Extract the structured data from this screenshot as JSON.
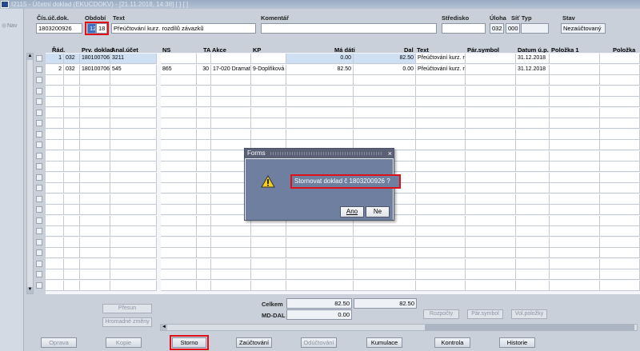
{
  "window": {
    "title": "I2115 - Účetní doklad (EKUCDOKV) - [21.11.2018, 14:38] [ ] [ ]"
  },
  "nav": {
    "label": "Nav"
  },
  "header": {
    "labels": {
      "cis_uc_dok": "Čís.úč.dok.",
      "obdobi": "Období",
      "text": "Text",
      "komentar": "Komentář",
      "stredisko": "Středisko",
      "uloha": "Úloha",
      "sit_typ": "Síť Typ",
      "stav": "Stav"
    },
    "values": {
      "cis_uc_dok": "1803200926",
      "obdobi_mesic": "12",
      "obdobi_rok": "18",
      "text": "Přeúčtování kurz. rozdílů závazků",
      "komentar": "",
      "stredisko": "",
      "uloha": "032",
      "sit": "000",
      "typ": "",
      "stav": "Nezaúčtovaný"
    }
  },
  "grid": {
    "columns": [
      "Řád.",
      "Prv. doklad",
      "Anal.účet",
      "NS",
      "TA Akce",
      "KP",
      "Má dáti",
      "Dal",
      "Text",
      "Pár.symbol",
      "Datum ú.p.",
      "Položka 1",
      "Položka"
    ],
    "rows": [
      {
        "rad": "1",
        "uloha": "032",
        "prv": "1801007067",
        "anal": "3211",
        "ns": "",
        "ta": "",
        "akce": "",
        "kp": "",
        "md": "0.00",
        "dal": "82.50",
        "text": "Přeúčtování kurz. r",
        "par": "",
        "datum": "31.12.2018"
      },
      {
        "rad": "2",
        "uloha": "032",
        "prv": "1801007067",
        "anal": "545",
        "ns": "865",
        "ta": "30",
        "akce": "17-020 Dramat",
        "kp": "9-Doplňková",
        "md": "82.50",
        "dal": "0.00",
        "text": "Přeúčtování kurz. r",
        "par": "",
        "datum": "31.12.2018"
      }
    ]
  },
  "totals": {
    "celkem_label": "Celkem",
    "celkem_md": "82.50",
    "celkem_dal": "82.50",
    "mddal_label": "MD-DAL",
    "mddal_value": "0.00"
  },
  "side_buttons": {
    "presun": "Přesun",
    "hromadne": "Hromadné změny",
    "rozpocty": "Rozpočty",
    "par_symbol": "Pár.symbol",
    "vol_polozky": "Vol.položky"
  },
  "bottom_buttons": {
    "oprava": "Oprava",
    "kopie": "Kopie",
    "storno": "Storno",
    "zauctovani": "Zaúčtování",
    "oductovani": "Odúčtování",
    "kumulace": "Kumulace",
    "kontrola": "Kontrola",
    "historie": "Historie"
  },
  "dialog": {
    "title": "Forms",
    "close": "×",
    "message": "Stornovat doklad č  1803200926 ?",
    "ano": "Ano",
    "ne": "Ne"
  },
  "colors": {
    "highlight": "#e0101a",
    "selected_row": "#cfe0f5",
    "dialog_body": "#6e7f9f"
  }
}
